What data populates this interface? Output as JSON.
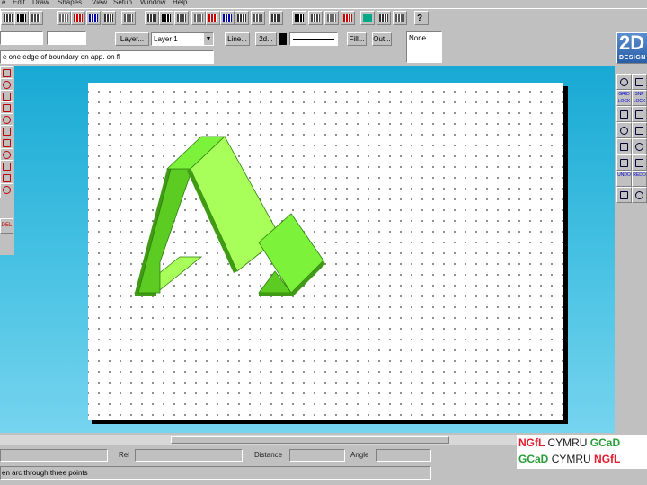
{
  "menu": [
    "e",
    "Edit",
    "Draw",
    "Shapes",
    "View",
    "Setup",
    "Window",
    "Help"
  ],
  "toolbar": {
    "icons": [
      "open-icon",
      "save-icon",
      "new-window-icon",
      "copy-window-icon",
      "print-preview-icon",
      "delete-icon",
      "text-icon",
      "clear-icon",
      "cut-icon",
      "paste-icon",
      "clipboard-icon",
      "select-icon",
      "grid-icon",
      "table-icon",
      "insert-icon",
      "symbol-icon",
      "layer-icon",
      "back-icon",
      "front-icon",
      "group-icon",
      "ungroup-icon",
      "screen-icon",
      "printer-icon",
      "wand-icon",
      "help-icon"
    ]
  },
  "properties": {
    "layer_button": "Layer...",
    "layer_value": "Layer 1",
    "line_button": "Line...",
    "fill_width_button": "2d...",
    "fill_button": "Fill...",
    "outline_button": "Out...",
    "fill_style": "None"
  },
  "prompt_text": "e one edge of boundary on app. on fl",
  "logo": {
    "big": "2D",
    "small": "DESIGN"
  },
  "right_tools": [
    {
      "name": "dots-tool",
      "label": ""
    },
    {
      "name": "rotate-tool",
      "label": ""
    },
    {
      "name": "grid-lock-tool",
      "label": "GRID LOCK"
    },
    {
      "name": "snap-lock-tool",
      "label": "SNP LOCK"
    },
    {
      "name": "square-tool",
      "label": ""
    },
    {
      "name": "measure-tool",
      "label": ""
    },
    {
      "name": "zoom-in-tool",
      "label": ""
    },
    {
      "name": "zoom-out-tool",
      "label": ""
    },
    {
      "name": "zoom-all-tool",
      "label": ""
    },
    {
      "name": "zoom-window-tool",
      "label": ""
    },
    {
      "name": "pan-tool",
      "label": ""
    },
    {
      "name": "redraw-tool",
      "label": ""
    },
    {
      "name": "undo-tool",
      "label": "UNDO"
    },
    {
      "name": "redo-tool",
      "label": "REDO"
    },
    {
      "name": "flip-tool",
      "label": ""
    },
    {
      "name": "info-tool",
      "label": ""
    }
  ],
  "left_tools": [
    "line-tool",
    "arc-tool",
    "curve-tool",
    "polygon-tool",
    "hatch-tool",
    "dimension-tool",
    "text-tool",
    "fill-tool",
    "symbol-tool",
    "layer-tool",
    "delete-tool",
    "",
    "",
    "",
    "",
    ""
  ],
  "left_tool_labels": [
    "",
    "",
    "",
    "",
    "",
    "",
    "",
    "",
    "",
    "",
    "",
    "",
    "",
    "DEL",
    "",
    ""
  ],
  "coords": {
    "rel": "Rel",
    "distance": "Distance",
    "angle": "Angle"
  },
  "status_text": "en arc through three points",
  "ngfl": {
    "row1_a": "NGfL",
    "row1_b": "CYMRU",
    "row1_c": "GCaD",
    "row2_a": "GCaD",
    "row2_b": "CYMRU",
    "row2_c": "NGfL"
  },
  "colors": {
    "workspace_top": "#18a9d4",
    "shape_light": "#a8ff5a",
    "shape_mid": "#7cf23a",
    "shape_dark": "#4cbc1a"
  }
}
